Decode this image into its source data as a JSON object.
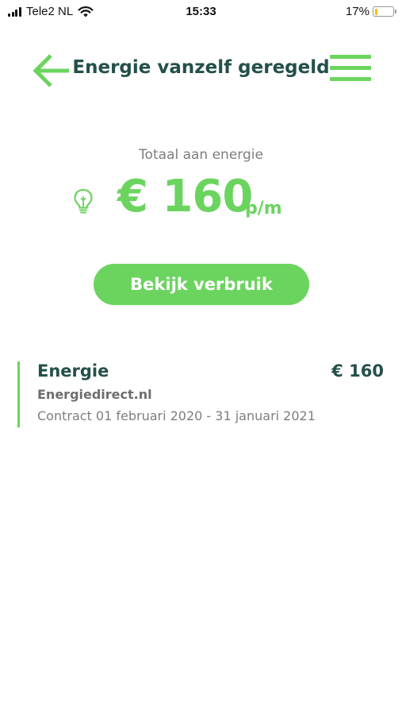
{
  "status_bar": {
    "carrier": "Tele2 NL",
    "time": "15:33",
    "battery": "17%",
    "battery_level": 0.17,
    "icons": [
      "signal-icon",
      "wifi-icon",
      "battery-icon"
    ]
  },
  "header": {
    "title": "Energie vanzelf geregeld",
    "back_icon": "arrow-left-icon",
    "menu_icon": "hamburger-menu-icon"
  },
  "summary": {
    "label": "Totaal aan energie",
    "amount": "€ 160",
    "unit": "p/m",
    "icon": "lightbulb-icon"
  },
  "actions": {
    "view_usage": "Bekijk verbruik"
  },
  "contract": {
    "name": "Energie",
    "amount": "€ 160",
    "supplier": "Energiedirect.nl",
    "period": "Contract 01 februari 2020 - 31 januari 2021"
  },
  "colors": {
    "accent": "#6bd45f",
    "title": "#24504a",
    "muted": "#7e7e7e",
    "battery": "#f5c400"
  }
}
